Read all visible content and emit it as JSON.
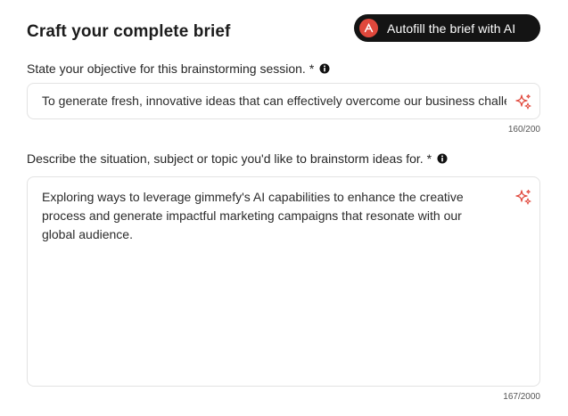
{
  "header": {
    "title": "Craft your complete brief",
    "autofill_label": "Autofill the brief with AI"
  },
  "objective": {
    "label": "State your objective for this brainstorming session.",
    "required_mark": "*",
    "value": "To generate fresh, innovative ideas that can effectively overcome our business challenges",
    "counter": "160/200"
  },
  "situation": {
    "label": "Describe the situation, subject or topic you'd like to brainstorm ideas for.",
    "required_mark": "*",
    "value": "Exploring ways to leverage gimmefy's AI capabilities to enhance the creative process and generate impactful marketing campaigns that resonate with our global audience.",
    "counter": "167/2000"
  },
  "icons": {
    "badge": "ai-badge-icon",
    "info": "info-icon",
    "sparkle": "sparkle-icon"
  },
  "colors": {
    "accent": "#e0483c",
    "button_bg": "#141414",
    "border": "#e3e3e3"
  }
}
